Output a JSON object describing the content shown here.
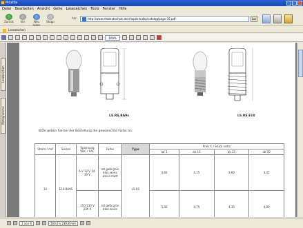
{
  "window": {
    "title": "Mozilla"
  },
  "menu": [
    "Datei",
    "Bearbeiten",
    "Ansicht",
    "Gehe",
    "Lesezeichen",
    "Tools",
    "Fenster",
    "Hilfe"
  ],
  "nav": {
    "back": "Zurück",
    "forward": "Vor",
    "reload": "Neu laden",
    "stop": "Stopp",
    "address_label": "Adr:",
    "address": "http://www.elektrotechnik.de/shop/ls-bulbs/catalog/page-35.pdf",
    "go": "Los",
    "print": "Drucken"
  },
  "links": {
    "label": "Lesezeichen"
  },
  "pdf_toolbar": {
    "zoom": "100%"
  },
  "side_tabs": {
    "tab1": "Lesezeichen",
    "tab2": "Piktogramme"
  },
  "products": [
    {
      "caption": "LS.RS.BA9s"
    },
    {
      "caption": "LS.RS.E10"
    }
  ],
  "intro_text": "Bitte geben Sie bei der Bestellung die gewünschte Farbe an:",
  "table": {
    "headers": {
      "strom": "Strom / mA",
      "sockel": "Sockel",
      "spannung": "Spannung VDC / VAC",
      "farbe": "Farbe",
      "type": "Type",
      "preis": "Preis € / Stück netto",
      "ab1": "ab 1",
      "ab10": "ab 10",
      "ab25": "ab 25",
      "ab50": "ab 50"
    },
    "strom": "14",
    "sockel": "E10 BA9S",
    "type": "LS.RS",
    "rows": [
      {
        "spannung": "6 V 12 V 24-30 V",
        "farben": "rot gelb grün blau weiss weiss-matt",
        "ab1": "4,60",
        "ab10": "4,15",
        "ab25": "3,60",
        "ab50": "3,45"
      },
      {
        "spannung": "110-130 V 230 V",
        "farben": "rot gelb grün blau weiss",
        "ab1": "5,30",
        "ab10": "4,75",
        "ab25": "4,35",
        "ab50": "4,00"
      }
    ]
  },
  "status": {
    "page": "1 von 6",
    "size": "160,0 x 239,8 mm"
  }
}
